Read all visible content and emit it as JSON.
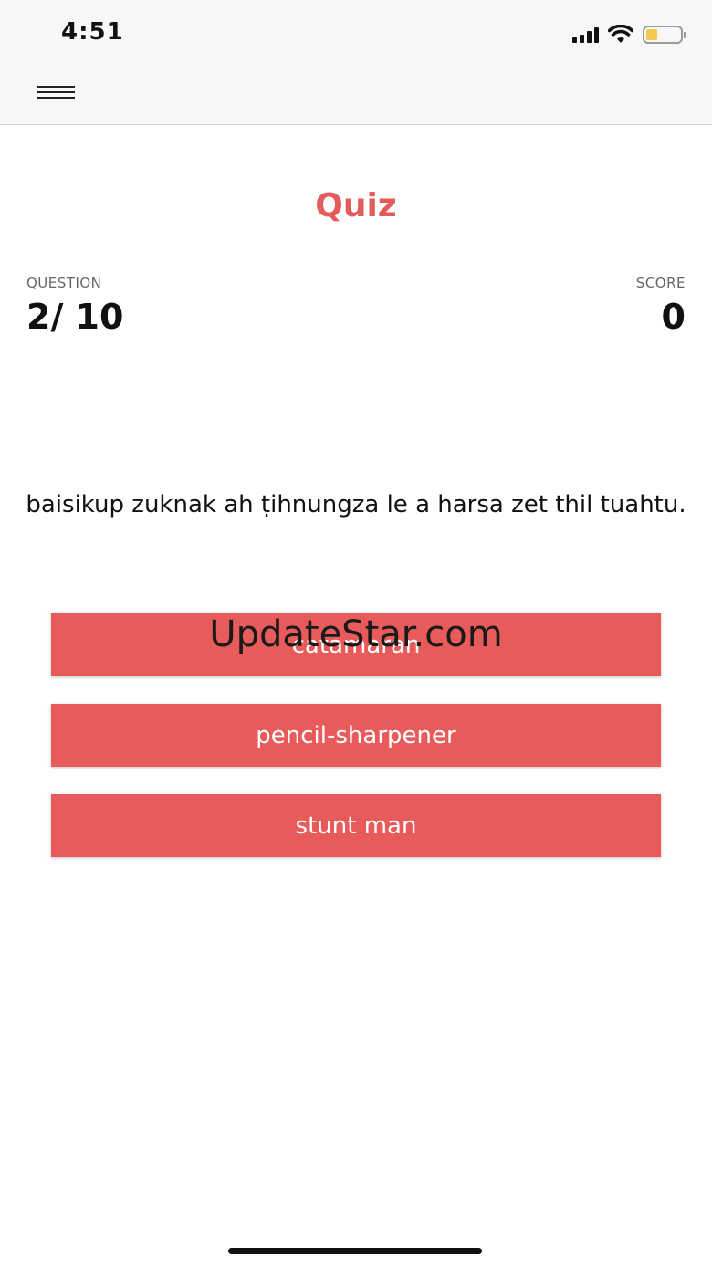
{
  "status_bar": {
    "time": "4:51",
    "icons": [
      "cellular-signal-icon",
      "wifi-icon",
      "battery-icon"
    ],
    "battery_color": "#f2c94c"
  },
  "nav": {
    "menu_icon": "hamburger-menu-icon"
  },
  "quiz": {
    "title": "Quiz",
    "question_label": "QUESTION",
    "question_progress": "2/ 10",
    "score_label": "SCORE",
    "score_value": "0",
    "question_text": "baisikup zuknak ah ṭihnungza le a harsa zet thil tuahtu.",
    "answers": [
      {
        "label": "catamaran"
      },
      {
        "label": "pencil-sharpener"
      },
      {
        "label": "stunt man"
      }
    ],
    "accent_color": "#e85b5b"
  },
  "watermark": {
    "text": "UpdateStar.com"
  }
}
